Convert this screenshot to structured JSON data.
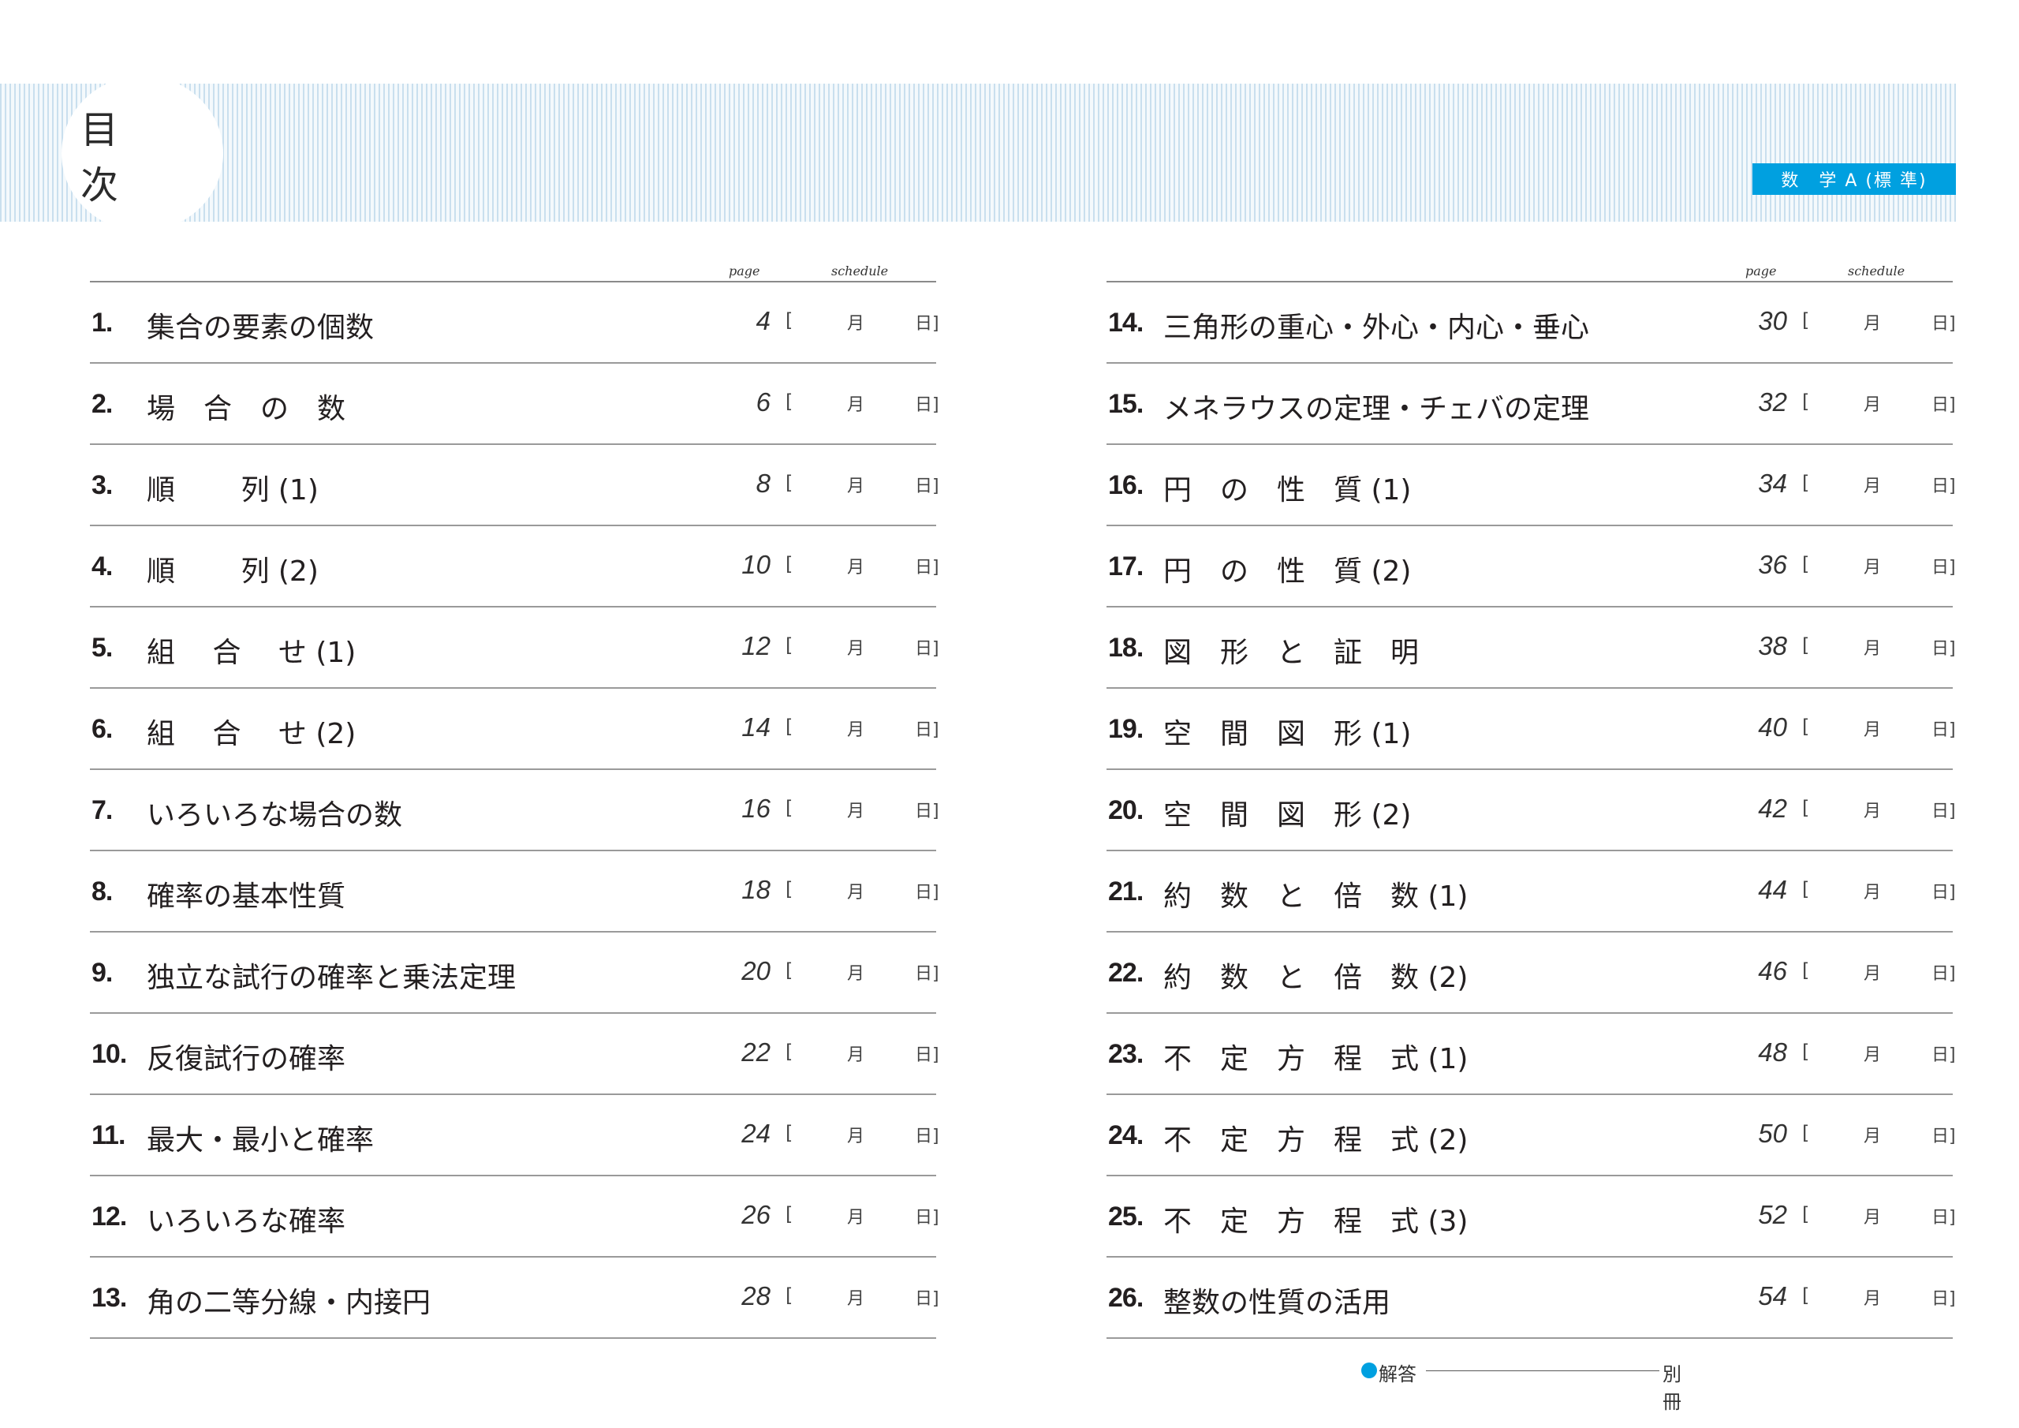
{
  "header": {
    "title": "目 次",
    "subject": "数　学 A (標 準)"
  },
  "column_headers": {
    "page": "page",
    "schedule": "schedule"
  },
  "schedule_marks": {
    "open": "[",
    "month": "月",
    "day": "日]"
  },
  "left": [
    {
      "num": "1.",
      "title": "集合の要素の個数",
      "page": "4"
    },
    {
      "num": "2.",
      "title": "場　合　の　数",
      "page": "6"
    },
    {
      "num": "3.",
      "title": "順　　 列 (1)",
      "page": "8"
    },
    {
      "num": "4.",
      "title": "順　　 列 (2)",
      "page": "10"
    },
    {
      "num": "5.",
      "title": "組　 合　 せ (1)",
      "page": "12"
    },
    {
      "num": "6.",
      "title": "組　 合　 せ (2)",
      "page": "14"
    },
    {
      "num": "7.",
      "title": "いろいろな場合の数",
      "page": "16"
    },
    {
      "num": "8.",
      "title": "確率の基本性質",
      "page": "18"
    },
    {
      "num": "9.",
      "title": "独立な試行の確率と乗法定理",
      "page": "20"
    },
    {
      "num": "10.",
      "title": "反復試行の確率",
      "page": "22"
    },
    {
      "num": "11.",
      "title": "最大・最小と確率",
      "page": "24"
    },
    {
      "num": "12.",
      "title": "いろいろな確率",
      "page": "26"
    },
    {
      "num": "13.",
      "title": "角の二等分線・内接円",
      "page": "28"
    }
  ],
  "right": [
    {
      "num": "14.",
      "title": "三角形の重心・外心・内心・垂心",
      "page": "30"
    },
    {
      "num": "15.",
      "title": "メネラウスの定理・チェバの定理",
      "page": "32"
    },
    {
      "num": "16.",
      "title": "円　の　性　質 (1)",
      "page": "34"
    },
    {
      "num": "17.",
      "title": "円　の　性　質 (2)",
      "page": "36"
    },
    {
      "num": "18.",
      "title": "図　形　と　証　明",
      "page": "38"
    },
    {
      "num": "19.",
      "title": "空　間　図　形 (1)",
      "page": "40"
    },
    {
      "num": "20.",
      "title": "空　間　図　形 (2)",
      "page": "42"
    },
    {
      "num": "21.",
      "title": "約　数　と　倍　数 (1)",
      "page": "44"
    },
    {
      "num": "22.",
      "title": "約　数　と　倍　数 (2)",
      "page": "46"
    },
    {
      "num": "23.",
      "title": "不　定　方　程　式 (1)",
      "page": "48"
    },
    {
      "num": "24.",
      "title": "不　定　方　程　式 (2)",
      "page": "50"
    },
    {
      "num": "25.",
      "title": "不　定　方　程　式 (3)",
      "page": "52"
    },
    {
      "num": "26.",
      "title": "整数の性質の活用",
      "page": "54"
    }
  ],
  "answers": {
    "label": "解答",
    "value": "別冊"
  },
  "colors": {
    "accent": "#00a0e0",
    "stripe": "#c9dfee"
  }
}
